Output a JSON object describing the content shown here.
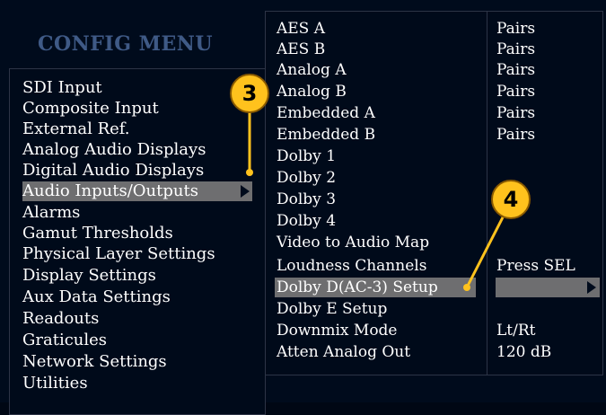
{
  "title": "CONFIG MENU",
  "left_menu": {
    "items": [
      {
        "label": "SDI Input"
      },
      {
        "label": "Composite Input"
      },
      {
        "label": "External Ref."
      },
      {
        "label": "Analog Audio Displays"
      },
      {
        "label": "Digital Audio Displays"
      },
      {
        "label": "Audio Inputs/Outputs",
        "selected": true
      },
      {
        "label": "Alarms"
      },
      {
        "label": "Gamut Thresholds"
      },
      {
        "label": "Physical Layer Settings"
      },
      {
        "label": "Display Settings"
      },
      {
        "label": "Aux Data Settings"
      },
      {
        "label": "Readouts"
      },
      {
        "label": "Graticules"
      },
      {
        "label": "Network Settings"
      },
      {
        "label": "Utilities"
      }
    ]
  },
  "submenu": {
    "items": [
      {
        "label": "AES A",
        "value": "Pairs"
      },
      {
        "label": "AES B",
        "value": "Pairs"
      },
      {
        "label": "Analog A",
        "value": "Pairs"
      },
      {
        "label": "Analog B",
        "value": "Pairs"
      },
      {
        "label": "Embedded A",
        "value": "Pairs"
      },
      {
        "label": "Embedded B",
        "value": "Pairs"
      },
      {
        "label": "Dolby 1",
        "value": ""
      },
      {
        "label": "Dolby 2",
        "value": ""
      },
      {
        "label": "Dolby 3",
        "value": ""
      },
      {
        "label": "Dolby 4",
        "value": ""
      },
      {
        "label": "Video to Audio Map",
        "value": ""
      },
      {
        "label": "Loudness Channels",
        "value": "Press SEL"
      },
      {
        "label": "Dolby D(AC-3) Setup",
        "value": "",
        "selected": true
      },
      {
        "label": "Dolby E Setup",
        "value": ""
      },
      {
        "label": "Downmix Mode",
        "value": "Lt/Rt"
      },
      {
        "label": "Atten Analog Out",
        "value": "120 dB"
      }
    ]
  },
  "callouts": {
    "step3": "3",
    "step4": "4"
  },
  "colors": {
    "background": "#000b1c",
    "highlight": "#6e6e70",
    "title": "#3f5a86",
    "callout": "#ffc21d",
    "leader": "#ffc21d"
  }
}
